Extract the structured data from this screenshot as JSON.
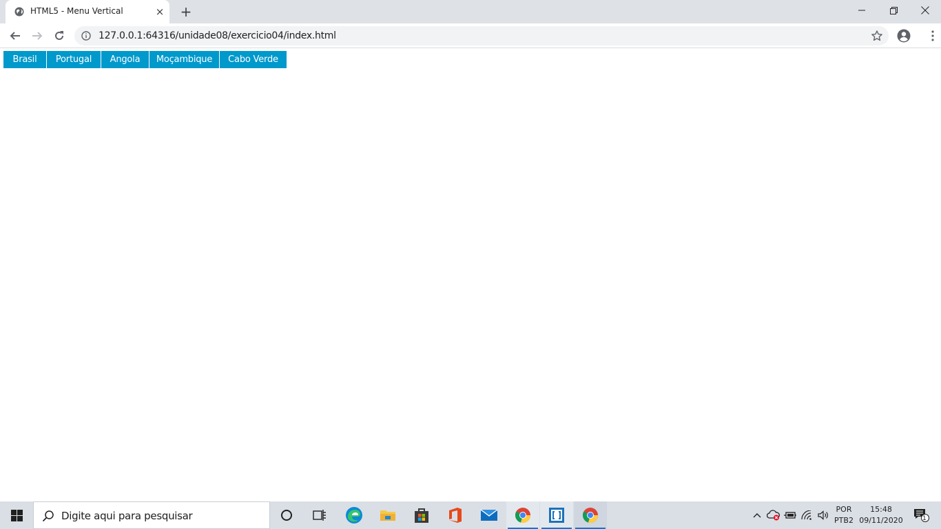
{
  "browser": {
    "tab_title": "HTML5 - Menu Vertical",
    "tab_close": "×",
    "new_tab": "+",
    "url": "127.0.0.1:64316/unidade08/exercicio04/index.html"
  },
  "menu": {
    "items": [
      {
        "label": "Brasil"
      },
      {
        "label": "Portugal"
      },
      {
        "label": "Angola"
      },
      {
        "label": "Moçambique"
      },
      {
        "label": "Cabo Verde"
      }
    ],
    "background": "#0099cc",
    "text_color": "#ffffff"
  },
  "taskbar": {
    "search_placeholder": "Digite aqui para pesquisar",
    "apps": [
      "cortana-icon",
      "task-view-icon",
      "edge-icon",
      "file-explorer-icon",
      "store-icon",
      "office-icon",
      "mail-icon",
      "chrome-icon",
      "brackets-icon",
      "chrome-icon"
    ],
    "language": "POR",
    "layout": "PTB2",
    "time": "15:48",
    "date": "09/11/2020",
    "notification_count": "1"
  }
}
